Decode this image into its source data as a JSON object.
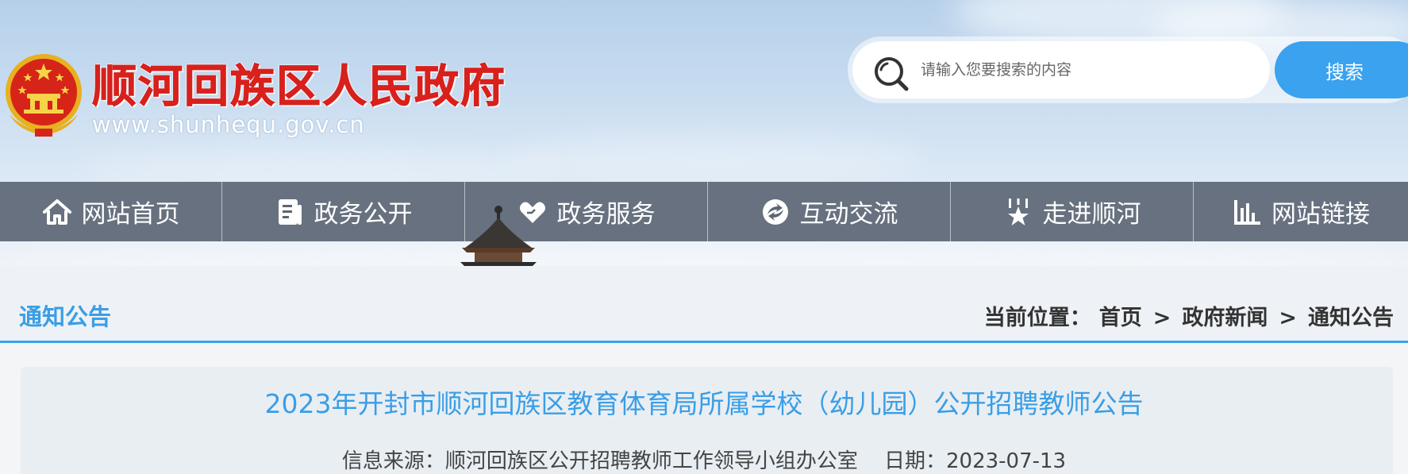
{
  "header": {
    "site_title": "顺河回族区人民政府",
    "site_url": "www.shunhequ.gov.cn",
    "emblem_icon": "national-emblem-icon"
  },
  "search": {
    "placeholder": "请输入您要搜索的内容",
    "button_label": "搜索",
    "icon": "search-icon"
  },
  "nav": {
    "items": [
      {
        "label": "网站首页",
        "icon": "home-icon"
      },
      {
        "label": "政务公开",
        "icon": "document-icon"
      },
      {
        "label": "政务服务",
        "icon": "heart-hands-icon"
      },
      {
        "label": "互动交流",
        "icon": "interaction-icon"
      },
      {
        "label": "走进顺河",
        "icon": "star-landmark-icon"
      },
      {
        "label": "网站链接",
        "icon": "bar-chart-icon"
      }
    ]
  },
  "section": {
    "title": "通知公告"
  },
  "breadcrumb": {
    "prefix": "当前位置：",
    "items": [
      "首页",
      "政府新闻",
      "通知公告"
    ],
    "separator": ">"
  },
  "article": {
    "title": "2023年开封市顺河回族区教育体育局所属学校（幼儿园）公开招聘教师公告",
    "source_label": "信息来源：",
    "source": "顺河回族区公开招聘教师工作领导小组办公室",
    "date_label": "日期：",
    "date": "2023-07-13"
  },
  "colors": {
    "accent": "#3aa2ef",
    "title_red": "#d8201c",
    "nav_bg": "#5c6674"
  }
}
